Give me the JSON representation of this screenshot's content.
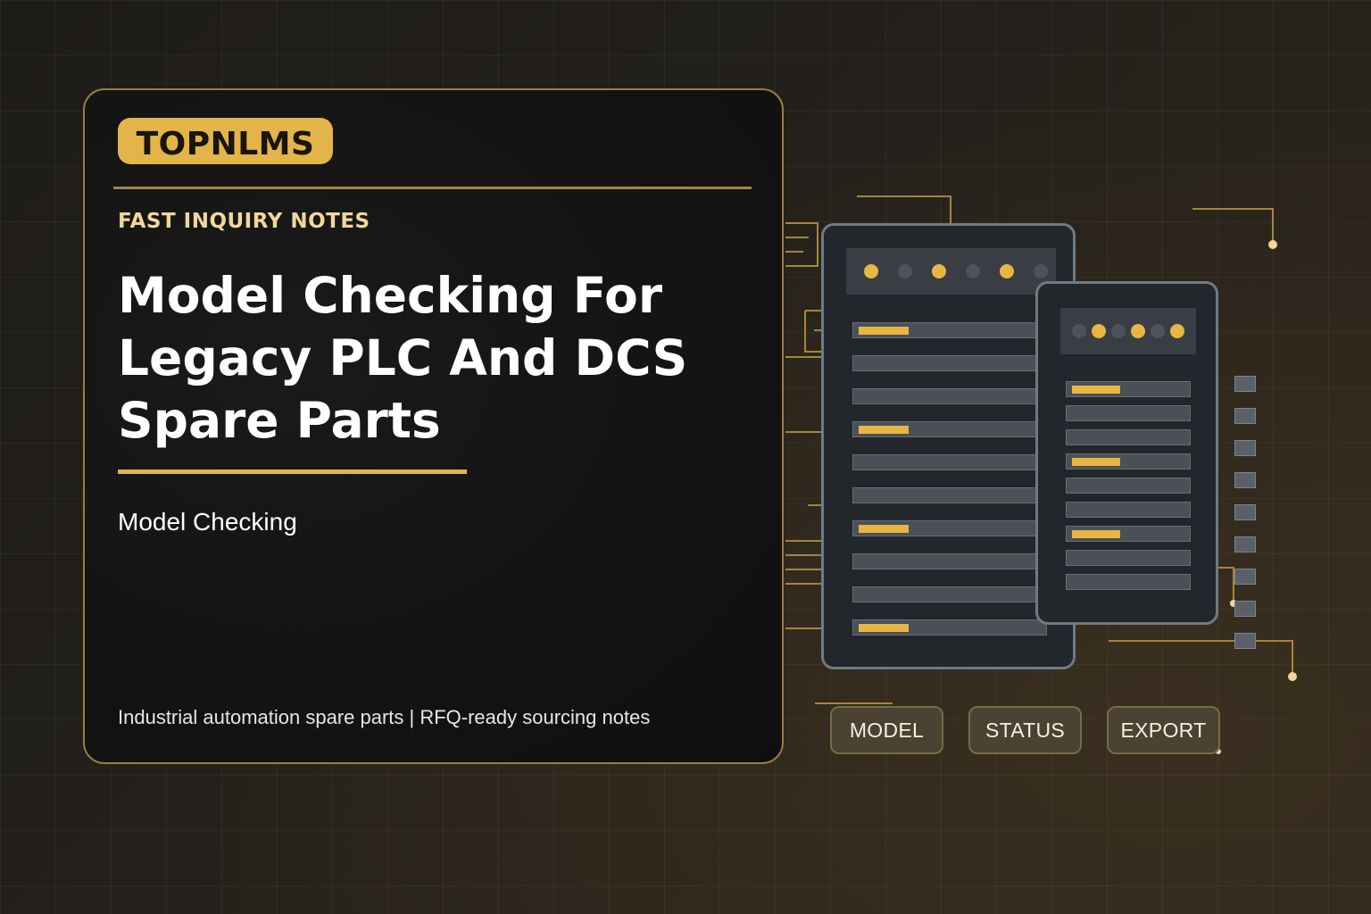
{
  "brand": {
    "name": "TOPNLMS"
  },
  "card": {
    "kicker": "FAST INQUIRY NOTES",
    "headline_lines": [
      "Model Checking For",
      "Legacy PLC And DCS",
      "Spare Parts"
    ],
    "subtitle": "Model Checking",
    "footer": "Industrial automation spare parts | RFQ-ready sourcing notes"
  },
  "buttons": {
    "model": "MODEL",
    "status": "STATUS",
    "export": "EXPORT"
  },
  "colors": {
    "accent": "#e2b44a",
    "card_border": "#9c7c3e",
    "card_bg": "#121212",
    "device_bg": "#23262a"
  },
  "icons": {
    "indicator": "status-dot",
    "row_marker": "highlight-bar"
  }
}
